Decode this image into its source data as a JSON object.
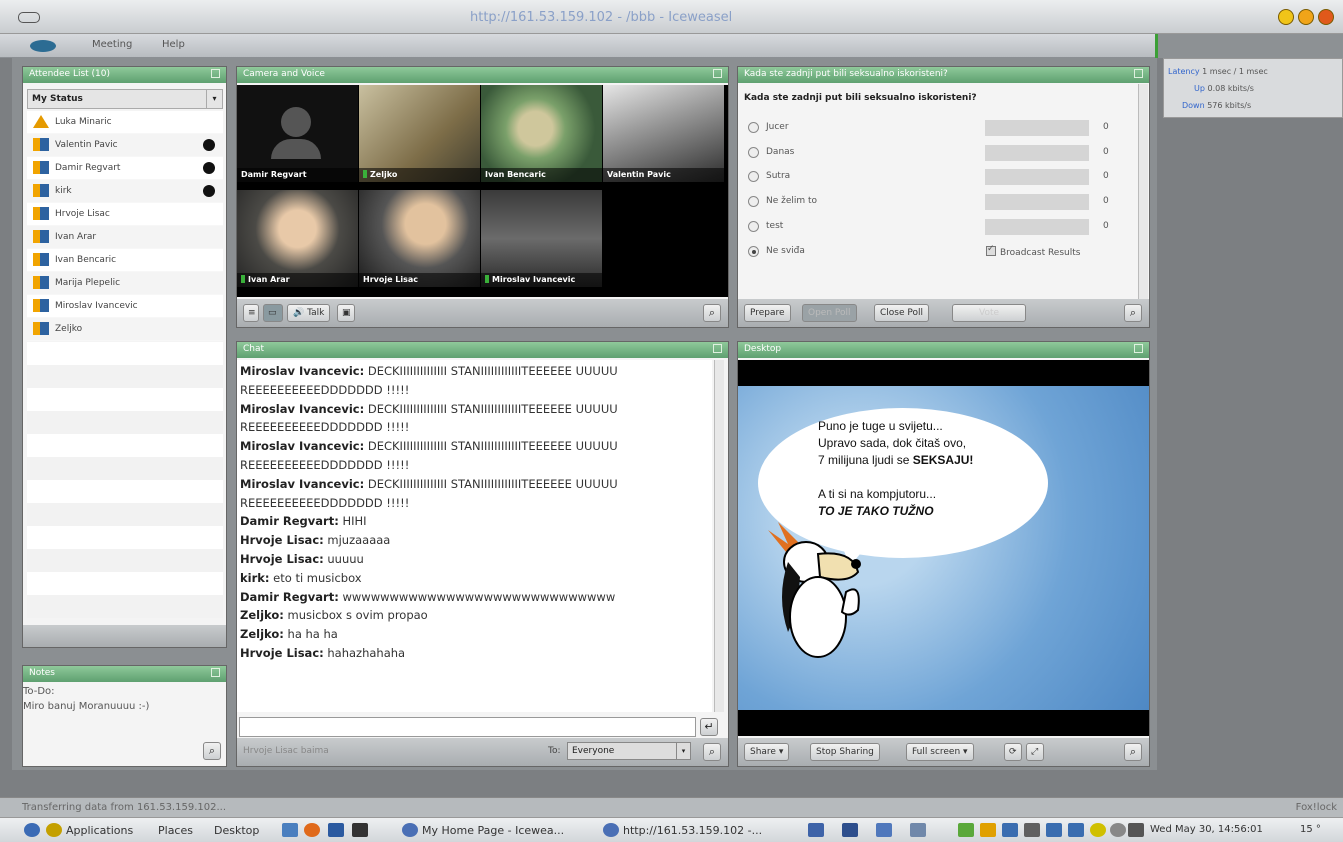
{
  "browser": {
    "title": "http://161.53.159.102 - /bbb - Iceweasel"
  },
  "menu": [
    "Meeting",
    "Help"
  ],
  "stats": {
    "latency_label": "Latency",
    "latency_value": "1 msec / 1 msec",
    "up_label": "Up",
    "up_value": "0.08 kbits/s",
    "down_label": "Down",
    "down_value": "576 kbits/s"
  },
  "attendees": {
    "title": "Attendee List (10)",
    "status": "My Status",
    "list": [
      {
        "name": "Luka Minaric",
        "role": "moderator",
        "hand": false
      },
      {
        "name": "Valentin Pavic",
        "role": "viewer",
        "hand": true
      },
      {
        "name": "Damir Regvart",
        "role": "viewer",
        "hand": true
      },
      {
        "name": "kirk",
        "role": "viewer",
        "hand": true
      },
      {
        "name": "Hrvoje Lisac",
        "role": "viewer",
        "hand": false
      },
      {
        "name": "Ivan Arar",
        "role": "viewer",
        "hand": false
      },
      {
        "name": "Ivan Bencaric",
        "role": "viewer",
        "hand": false
      },
      {
        "name": "Marija Plepelic",
        "role": "viewer",
        "hand": false
      },
      {
        "name": "Miroslav Ivancevic",
        "role": "viewer",
        "hand": false
      },
      {
        "name": "Zeljko",
        "role": "viewer",
        "hand": false
      }
    ]
  },
  "notes": {
    "title": "Notes",
    "lines": [
      "To-Do:",
      "Miro banuj Moranuuuu :-)"
    ]
  },
  "camera": {
    "title": "Camera and Voice",
    "videos": [
      {
        "label": "Damir Regvart",
        "mic": false
      },
      {
        "label": "Zeljko",
        "mic": true
      },
      {
        "label": "Ivan Bencaric",
        "mic": false
      },
      {
        "label": "Valentin Pavic",
        "mic": false
      },
      {
        "label": "Ivan Arar",
        "mic": true
      },
      {
        "label": "Hrvoje Lisac",
        "mic": false
      },
      {
        "label": "Miroslav Ivancevic",
        "mic": true
      }
    ],
    "talk_label": "Talk"
  },
  "poll": {
    "title": "Kada ste zadnji put bili seksualno iskoristeni?",
    "question": "Kada ste zadnji put bili seksualno iskoristeni?",
    "options": [
      {
        "label": "Jucer",
        "count": "0",
        "selected": false
      },
      {
        "label": "Danas",
        "count": "0",
        "selected": false
      },
      {
        "label": "Sutra",
        "count": "0",
        "selected": false
      },
      {
        "label": "Ne želim to",
        "count": "0",
        "selected": false
      },
      {
        "label": "test",
        "count": "0",
        "selected": false
      },
      {
        "label": "Ne sviđa",
        "count": "0",
        "selected": true
      }
    ],
    "broadcast": "Broadcast Results",
    "buttons": [
      "Prepare",
      "Open Poll",
      "Close Poll",
      "Vote"
    ]
  },
  "chat": {
    "title": "Chat",
    "messages": [
      {
        "who": "Miroslav Ivancevic:",
        "text": "DECKIIIIIIIIIIIIII STANIIIIIIIIIIIITEEEEEE UUUUU REEEEEEEEEEDDDDDDD !!!!!"
      },
      {
        "who": "Miroslav Ivancevic:",
        "text": "DECKIIIIIIIIIIIIII STANIIIIIIIIIIIITEEEEEE UUUUU REEEEEEEEEEDDDDDDD !!!!!"
      },
      {
        "who": "Miroslav Ivancevic:",
        "text": "DECKIIIIIIIIIIIIII STANIIIIIIIIIIIITEEEEEE UUUUU REEEEEEEEEEDDDDDDD !!!!!"
      },
      {
        "who": "Miroslav Ivancevic:",
        "text": "DECKIIIIIIIIIIIIII STANIIIIIIIIIIIITEEEEEE UUUUU REEEEEEEEEEDDDDDDD !!!!!"
      },
      {
        "who": "Damir Regvart:",
        "text": "HIHI"
      },
      {
        "who": "Hrvoje Lisac:",
        "text": "mjuzaaaaa"
      },
      {
        "who": "Hrvoje Lisac:",
        "text": "uuuuu"
      },
      {
        "who": "kirk:",
        "text": "eto ti musicbox"
      },
      {
        "who": "Damir Regvart:",
        "text": "wwwwwwwwwwwwwwwwwwwwwwwwwwwww"
      },
      {
        "who": "Zeljko:",
        "text": "musicbox s ovim propao"
      },
      {
        "who": "Zeljko:",
        "text": "ha ha ha"
      },
      {
        "who": "Hrvoje Lisac:",
        "text": "hahazhahaha"
      }
    ],
    "input_name": "Hrvoje Lisac baima",
    "to_label": "To:",
    "to_value": "Everyone"
  },
  "share": {
    "title": "Desktop",
    "bubble": {
      "line1": "Puno je tuge u svijetu...",
      "line2": "Upravo sada, dok čitaš ovo,",
      "line3a": "7 milijuna ljudi se ",
      "line3b": "SEKSAJU!",
      "line4": "A ti si na kompjutoru...",
      "line5": "TO JE TAKO TUŽNO"
    },
    "buttons": [
      "Share",
      "Stop Sharing",
      "Full screen"
    ]
  },
  "statusbar": {
    "text": "Transferring data from 161.53.159.102...",
    "right": "Fox!lock"
  },
  "taskbar": {
    "applications": "Applications",
    "places": "Places",
    "desktop": "Desktop",
    "task1": "My Home Page - Icewea...",
    "task2": "http://161.53.159.102 -...",
    "clock": "Wed May 30, 14:56:01",
    "temp": "15 °"
  }
}
